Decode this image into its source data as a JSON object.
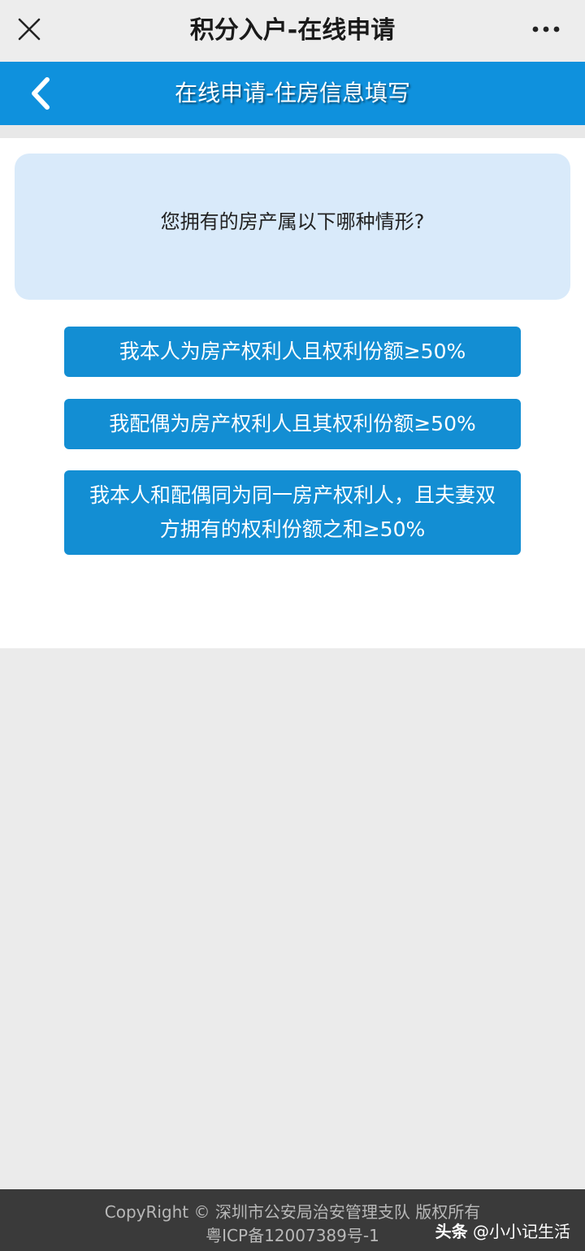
{
  "topbar": {
    "title": "积分入户-在线申请"
  },
  "header": {
    "title": "在线申请-住房信息填写"
  },
  "question": {
    "text": "您拥有的房产属以下哪种情形?"
  },
  "options": [
    {
      "label": "我本人为房产权利人且权利份额≥50%"
    },
    {
      "label": "我配偶为房产权利人且其权利份额≥50%"
    },
    {
      "label": "我本人和配偶同为同一房产权利人，且夫妻双方拥有的权利份额之和≥50%"
    }
  ],
  "footer": {
    "line1": "CopyRight © 深圳市公安局治安管理支队 版权所有",
    "line2": "粤ICP备12007389号-1"
  },
  "watermark": {
    "brand": "头条",
    "handle": "@小小记生活"
  },
  "colors": {
    "primary_blue": "#0f91dd",
    "button_blue": "#138ed3",
    "question_bg": "#d9eafa"
  }
}
